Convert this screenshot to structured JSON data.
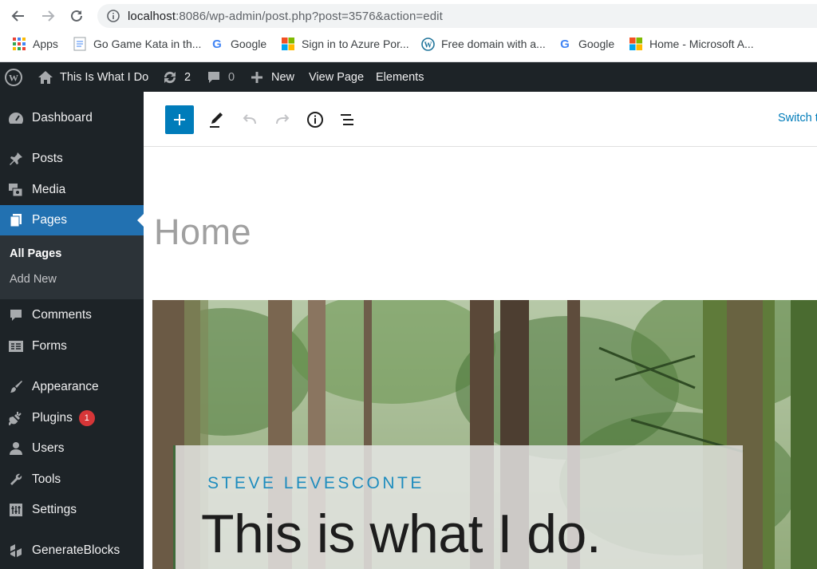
{
  "browser": {
    "url_host": "localhost",
    "url_rest": ":8086/wp-admin/post.php?post=3576&action=edit",
    "bookmarks": [
      {
        "label": "Apps",
        "icon": "apps-grid-icon"
      },
      {
        "label": "Go Game Kata in th...",
        "icon": "page-icon"
      },
      {
        "label": "Google",
        "icon": "google-icon"
      },
      {
        "label": "Sign in to Azure Por...",
        "icon": "microsoft-icon"
      },
      {
        "label": "Free domain with a...",
        "icon": "wordpress-icon"
      },
      {
        "label": "Google",
        "icon": "google-icon"
      },
      {
        "label": "Home - Microsoft A...",
        "icon": "microsoft-icon"
      }
    ]
  },
  "adminbar": {
    "site_name": "This Is What I Do",
    "updates_count": "2",
    "comments_count": "0",
    "new_label": "New",
    "view_page_label": "View Page",
    "elements_label": "Elements"
  },
  "sidebar": {
    "items": [
      {
        "label": "Dashboard",
        "icon": "dashboard-icon"
      },
      {
        "label": "Posts",
        "icon": "pin-icon"
      },
      {
        "label": "Media",
        "icon": "media-icon"
      },
      {
        "label": "Pages",
        "icon": "pages-icon"
      },
      {
        "label": "Comments",
        "icon": "comment-icon"
      },
      {
        "label": "Forms",
        "icon": "forms-icon"
      },
      {
        "label": "Appearance",
        "icon": "brush-icon"
      },
      {
        "label": "Plugins",
        "icon": "plug-icon"
      },
      {
        "label": "Users",
        "icon": "users-icon"
      },
      {
        "label": "Tools",
        "icon": "wrench-icon"
      },
      {
        "label": "Settings",
        "icon": "settings-icon"
      },
      {
        "label": "GenerateBlocks",
        "icon": "generateblocks-icon"
      }
    ],
    "plugins_badge": "1",
    "submenu": {
      "all_pages": "All Pages",
      "add_new": "Add New"
    }
  },
  "editor": {
    "switch_label": "Switch t",
    "post_title": "Home",
    "hero_kicker": "STEVE LEVESCONTE",
    "hero_title": "This is what I do."
  },
  "colors": {
    "admin_dark": "#1d2327",
    "accent_blue": "#2271b1",
    "button_blue": "#007cba",
    "badge_red": "#d63638"
  }
}
